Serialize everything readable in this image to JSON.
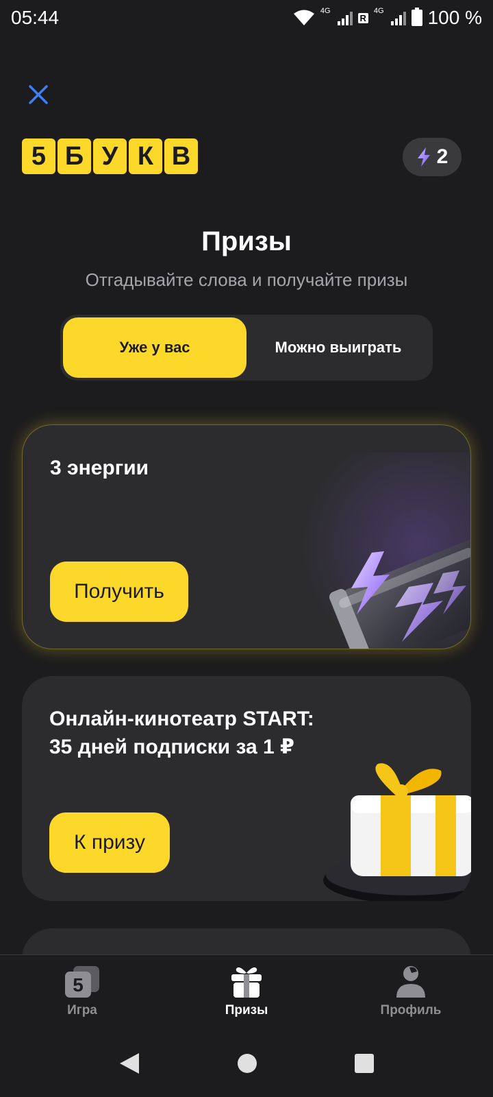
{
  "status": {
    "time": "05:44",
    "net1": "4G",
    "roaming": "R",
    "net2": "4G",
    "battery": "100 %"
  },
  "header": {
    "logo_letters": [
      "5",
      "Б",
      "У",
      "К",
      "В"
    ],
    "energy_count": "2"
  },
  "page": {
    "title": "Призы",
    "subtitle": "Отгадывайте слова и получайте призы"
  },
  "tabs": [
    {
      "label": "Уже у вас",
      "active": true
    },
    {
      "label": "Можно выиграть",
      "active": false
    }
  ],
  "cards": [
    {
      "title": "3 энергии",
      "button": "Получить"
    },
    {
      "title_line1": "Онлайн-кинотеатр START:",
      "title_line2": "35 дней подписки за 1 ₽",
      "button": "К призу"
    }
  ],
  "bottom_nav": [
    {
      "label": "Игра",
      "icon": "game-tile-icon"
    },
    {
      "label": "Призы",
      "icon": "gift-icon",
      "active": true
    },
    {
      "label": "Профиль",
      "icon": "profile-icon"
    }
  ],
  "colors": {
    "accent": "#fcd82a",
    "background": "#1c1c1e",
    "card": "#2c2c2e",
    "close": "#3d7ff5"
  }
}
